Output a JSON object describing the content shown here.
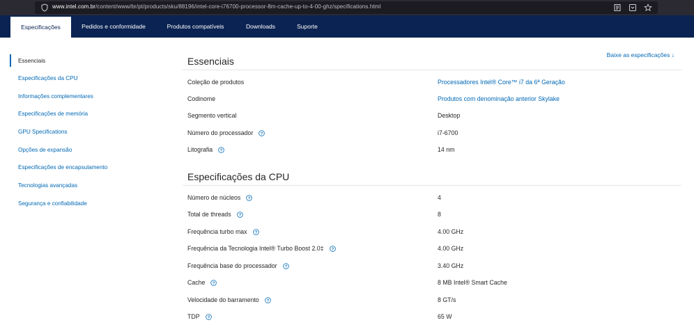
{
  "browser": {
    "url_host": "www.intel.com.br",
    "url_path": "/content/www/br/pt/products/sku/88196/intel-core-i76700-processor-8m-cache-up-to-4-00-ghz/specifications.html"
  },
  "tabs": [
    {
      "label": "Especificações",
      "active": true
    },
    {
      "label": "Pedidos e conformidade",
      "active": false
    },
    {
      "label": "Produtos compatíveis",
      "active": false
    },
    {
      "label": "Downloads",
      "active": false
    },
    {
      "label": "Suporte",
      "active": false
    }
  ],
  "sidebar": {
    "items": [
      {
        "label": "Essenciais",
        "active": true
      },
      {
        "label": "Especificações da CPU",
        "active": false
      },
      {
        "label": "Informações complementares",
        "active": false
      },
      {
        "label": "Especificações de memória",
        "active": false
      },
      {
        "label": "GPU Specifications",
        "active": false
      },
      {
        "label": "Opções de expansão",
        "active": false
      },
      {
        "label": "Especificações de encapsulamento",
        "active": false
      },
      {
        "label": "Tecnologias avançadas",
        "active": false
      },
      {
        "label": "Segurança e confiabilidade",
        "active": false
      }
    ]
  },
  "download_link": "Baixe as especificações ↓",
  "sections": [
    {
      "title": "Essenciais",
      "rows": [
        {
          "label": "Coleção de produtos",
          "value": "Processadores Intel® Core™ i7 da 6ª Geração",
          "link": true,
          "help": false
        },
        {
          "label": "Codinome",
          "value": "Produtos com denominação anterior Skylake",
          "link": true,
          "help": false
        },
        {
          "label": "Segmento vertical",
          "value": "Desktop",
          "link": false,
          "help": false
        },
        {
          "label": "Número do processador",
          "value": "i7-6700",
          "link": false,
          "help": true
        },
        {
          "label": "Litografia",
          "value": "14 nm",
          "link": false,
          "help": true
        }
      ]
    },
    {
      "title": "Especificações da CPU",
      "rows": [
        {
          "label": "Número de núcleos",
          "value": "4",
          "link": false,
          "help": true
        },
        {
          "label": "Total de threads",
          "value": "8",
          "link": false,
          "help": true
        },
        {
          "label": "Frequência turbo max",
          "value": "4.00 GHz",
          "link": false,
          "help": true
        },
        {
          "label": "Frequência da Tecnologia Intel® Turbo Boost 2.0‡",
          "value": "4.00 GHz",
          "link": false,
          "help": true
        },
        {
          "label": "Frequência base do processador",
          "value": "3.40 GHz",
          "link": false,
          "help": true
        },
        {
          "label": "Cache",
          "value": "8 MB Intel® Smart Cache",
          "link": false,
          "help": true
        },
        {
          "label": "Velocidade do barramento",
          "value": "8 GT/s",
          "link": false,
          "help": true
        },
        {
          "label": "TDP",
          "value": "65 W",
          "link": false,
          "help": true
        }
      ]
    }
  ],
  "colors": {
    "nav_bg": "#0b2352",
    "link": "#0068b5",
    "text": "#262626"
  }
}
